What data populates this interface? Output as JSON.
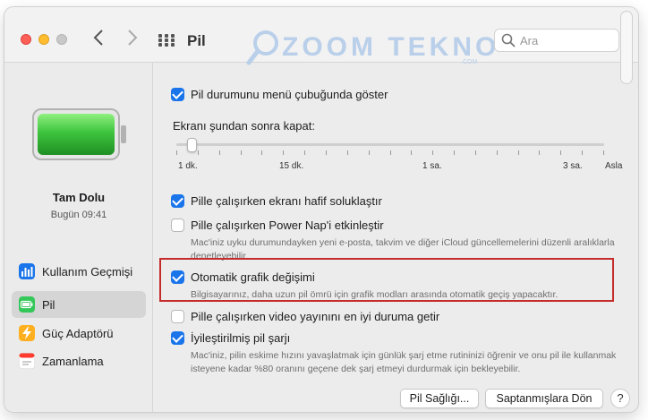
{
  "window": {
    "title": "Pil"
  },
  "watermark": {
    "text": "ZOOM TEKNO",
    "sub": ".COM"
  },
  "search": {
    "placeholder": "Ara"
  },
  "status": {
    "title": "Tam Dolu",
    "time": "Bugün 09:41",
    "battery_level": 1.0,
    "battery_color": "#3ec43e"
  },
  "sidebar": {
    "items": [
      {
        "label": "Kullanım Geçmişi",
        "icon": "usage-history-icon",
        "color": "#1a74ea"
      },
      {
        "label": "Pil",
        "icon": "battery-icon",
        "color": "#34c759"
      },
      {
        "label": "Güç Adaptörü",
        "icon": "power-adapter-icon",
        "color": "#ffb020"
      },
      {
        "label": "Zamanlama",
        "icon": "calendar-icon",
        "color": "#ff3b30"
      }
    ],
    "selected_index": 1
  },
  "options": {
    "menu_bar": {
      "label": "Pil durumunu menü çubuğunda göster",
      "checked": true
    },
    "screen_off": {
      "label": "Ekranı şundan sonra kapat:"
    },
    "slider": {
      "labels": [
        "1 dk.",
        "15 dk.",
        "1 sa.",
        "3 sa.",
        "Asla"
      ],
      "value": "1 dk."
    },
    "dim_display": {
      "label": "Pille çalışırken ekranı hafif soluklaştır",
      "checked": true
    },
    "power_nap": {
      "label": "Pille çalışırken Power Nap'i etkinleştir",
      "checked": false,
      "desc": "Mac'iniz uyku durumundayken yeni e-posta, takvim ve diğer iCloud güncellemelerini düzenli aralıklarla denetleyebilir."
    },
    "auto_graphics": {
      "label": "Otomatik grafik değişimi",
      "checked": true,
      "desc": "Bilgisayarınız, daha uzun pil ömrü için grafik modları arasında otomatik geçiş yapacaktır."
    },
    "video_streaming": {
      "label": "Pille çalışırken video yayınını en iyi duruma getir",
      "checked": false
    },
    "optimized_charging": {
      "label": "İyileştirilmiş pil şarjı",
      "checked": true,
      "desc": "Mac'iniz, pilin eskime hızını yavaşlatmak için günlük şarj etme rutininizi öğrenir ve onu pil ile kullanmak isteyene kadar %80 oranını geçene dek şarj etmeyi durdurmak için bekleyebilir."
    }
  },
  "buttons": {
    "battery_health": "Pil Sağlığı...",
    "restore_defaults": "Saptanmışlara Dön",
    "help": "?"
  },
  "colors": {
    "accent": "#1a74ea",
    "highlight_border": "#c62b2b"
  }
}
